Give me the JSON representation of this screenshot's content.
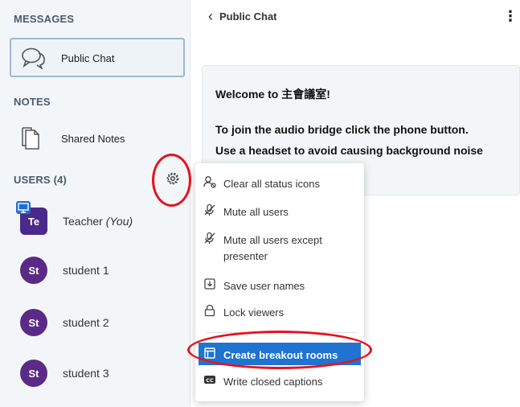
{
  "sidebar": {
    "messages_title": "MESSAGES",
    "public_chat_label": "Public Chat",
    "notes_title": "NOTES",
    "shared_notes_label": "Shared Notes",
    "users_title": "USERS (4)",
    "users": [
      {
        "initials": "Te",
        "name": "Teacher",
        "suffix": "(You)"
      },
      {
        "initials": "St",
        "name": "student 1"
      },
      {
        "initials": "St",
        "name": "student 2"
      },
      {
        "initials": "St",
        "name": "student 3"
      }
    ]
  },
  "header": {
    "title": "Public Chat",
    "kebab": "⋮"
  },
  "welcome": {
    "title": "Welcome to 主會議室!",
    "line1": "To join the audio bridge click the phone button.",
    "line2": "Use a headset to avoid causing background noise"
  },
  "menu": {
    "items": [
      {
        "label": "Clear all status icons",
        "icon": "clear-status-icon"
      },
      {
        "label": "Mute all users",
        "icon": "mute-icon"
      },
      {
        "label": "Mute all users except presenter",
        "line1": "Mute all users except",
        "line2": "presenter",
        "icon": "mute-icon"
      },
      {
        "label": "Save user names",
        "icon": "save-icon"
      },
      {
        "label": "Lock viewers",
        "icon": "lock-icon"
      },
      {
        "label": "Create breakout rooms",
        "icon": "breakout-rooms-icon"
      },
      {
        "label": "Write closed captions",
        "icon": "closed-captions-icon"
      }
    ]
  },
  "colors": {
    "accent": "#1f73d1",
    "avatar": "#5b2a86",
    "annotation": "#e8121c",
    "sidebar_bg": "#f3f6f9"
  }
}
